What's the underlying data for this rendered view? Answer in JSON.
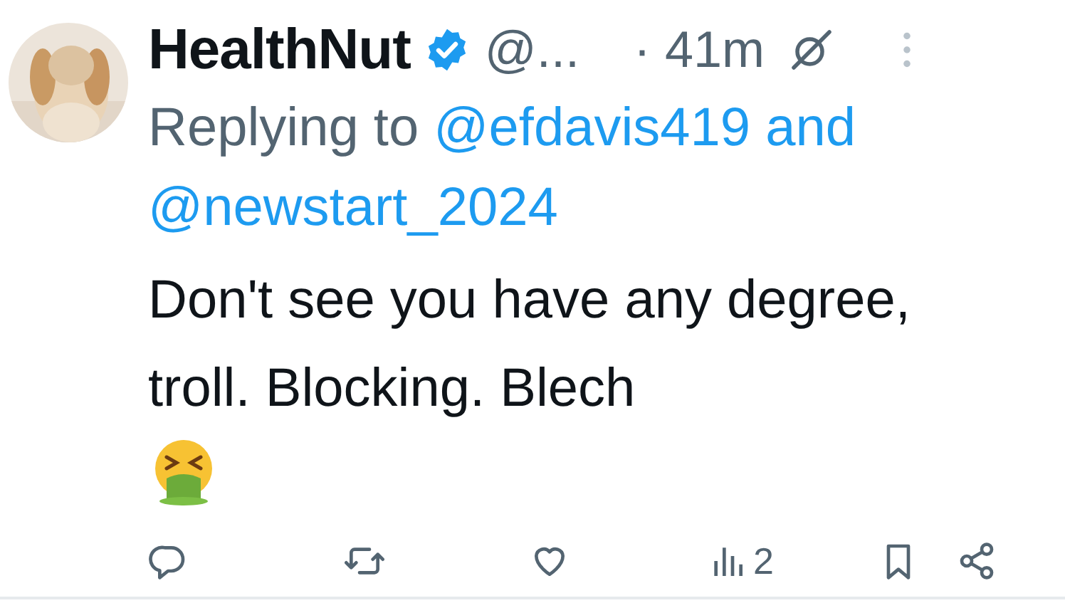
{
  "post": {
    "author": {
      "name": "HealthNut",
      "verified": true,
      "handle": "@...",
      "time": "· 41m"
    },
    "reply_to": {
      "prefix": "Replying to",
      "mentions": [
        "@efdavis419",
        "@newstart_2024"
      ],
      "joiner": "and"
    },
    "text": "Don't see you have any degree, troll. Blocking. Blech",
    "actions": [
      {
        "kind": "reply"
      },
      {
        "kind": "repost"
      },
      {
        "kind": "like"
      },
      {
        "kind": "views",
        "count": "2"
      },
      {
        "kind": "bookmark"
      },
      {
        "kind": "share"
      }
    ]
  }
}
